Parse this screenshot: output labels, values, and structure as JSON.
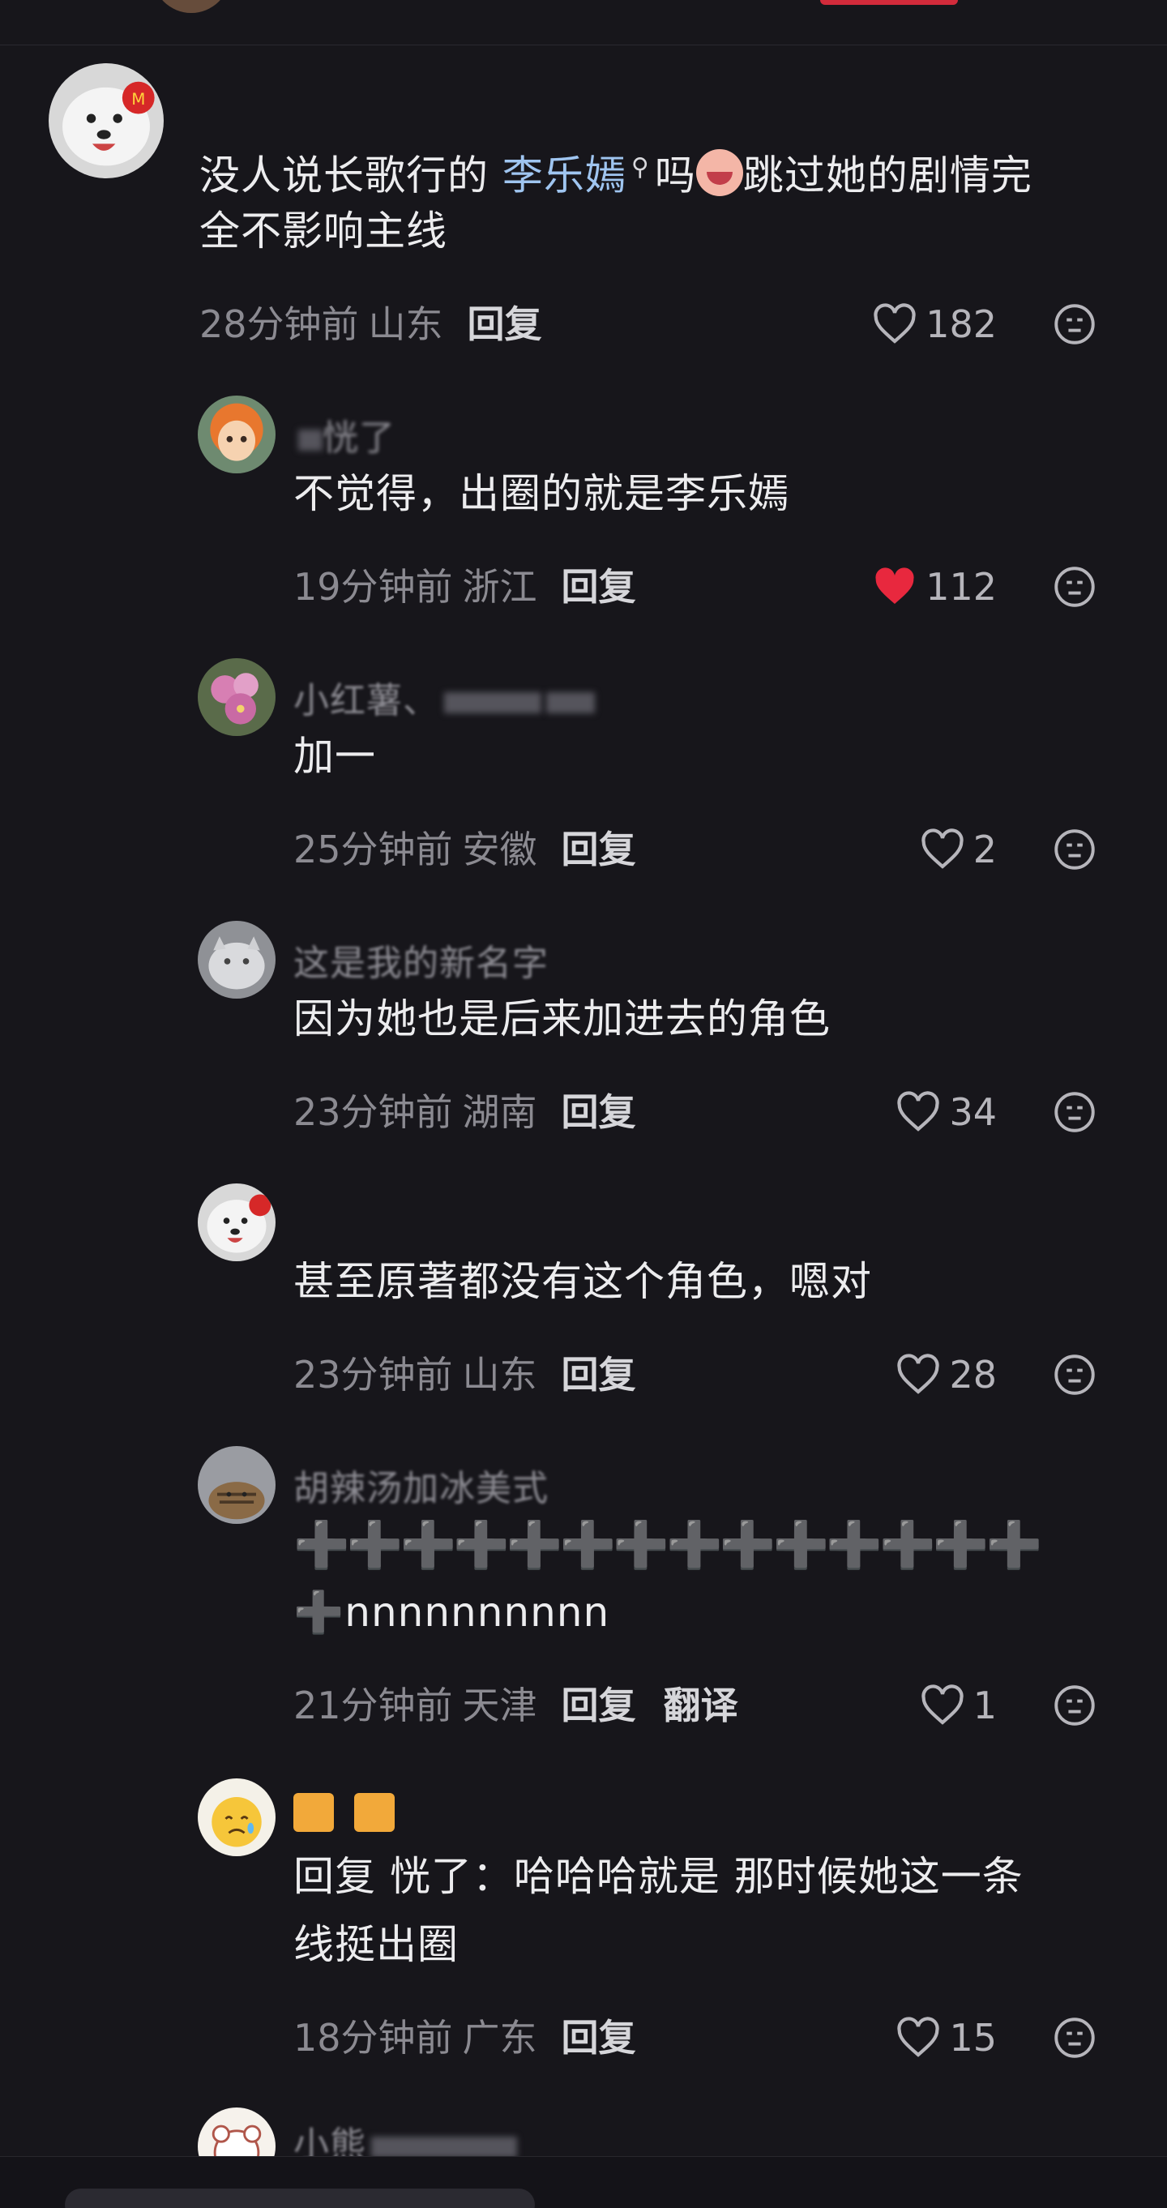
{
  "comments": [
    {
      "name": "",
      "text_line1_prefix": "没人说长歌行的 ",
      "text_link": "李乐嫣",
      "text_line1_suffix": "吗",
      "text_line1_end": "跳过她的剧情完",
      "text_line2": "全不影响主线",
      "time": "28分钟前",
      "region": "山东",
      "reply": "回复",
      "likes": "182",
      "liked": false,
      "avatar": "samoyed-dog"
    },
    {
      "name": "恍了",
      "text": "不觉得，出圈的就是李乐嫣",
      "time": "19分钟前",
      "region": "浙江",
      "reply": "回复",
      "likes": "112",
      "liked": true,
      "avatar": "anime-girl-orange-hair"
    },
    {
      "name": "小红薯、",
      "text": "加一",
      "time": "25分钟前",
      "region": "安徽",
      "reply": "回复",
      "likes": "2",
      "liked": false,
      "avatar": "pink-flowers"
    },
    {
      "name": "这是我的新名字",
      "text": "因为她也是后来加进去的角色",
      "time": "23分钟前",
      "region": "湖南",
      "reply": "回复",
      "likes": "34",
      "liked": false,
      "avatar": "grey-cat"
    },
    {
      "name": "",
      "text": "甚至原著都没有这个角色，嗯对",
      "time": "23分钟前",
      "region": "山东",
      "reply": "回复",
      "likes": "28",
      "liked": false,
      "avatar": "samoyed-dog"
    },
    {
      "name": "胡辣汤加冰美式",
      "text_line1": "➕➕➕➕➕➕➕➕➕➕➕➕➕➕",
      "text_line2": "➕nnnnnnnnnn",
      "time": "21分钟前",
      "region": "天津",
      "reply": "回复",
      "translate": "翻译",
      "likes": "1",
      "liked": false,
      "avatar": "tabby-cat"
    },
    {
      "name": "",
      "text_line1": "回复 恍了：哈哈哈就是 那时候她这一条",
      "text_line2": "线挺出圈",
      "time": "18分钟前",
      "region": "广东",
      "reply": "回复",
      "likes": "15",
      "liked": false,
      "avatar": "crying-emoji-cartoon"
    },
    {
      "name": "小熊",
      "avatar": "bear-cartoon"
    }
  ],
  "icons": {
    "like": "heart-outline-icon",
    "liked": "heart-filled-icon",
    "react": "neutral-face-icon"
  },
  "colors": {
    "background": "#17161b",
    "liked_heart": "#e8283e",
    "link": "#9fc5f0"
  }
}
